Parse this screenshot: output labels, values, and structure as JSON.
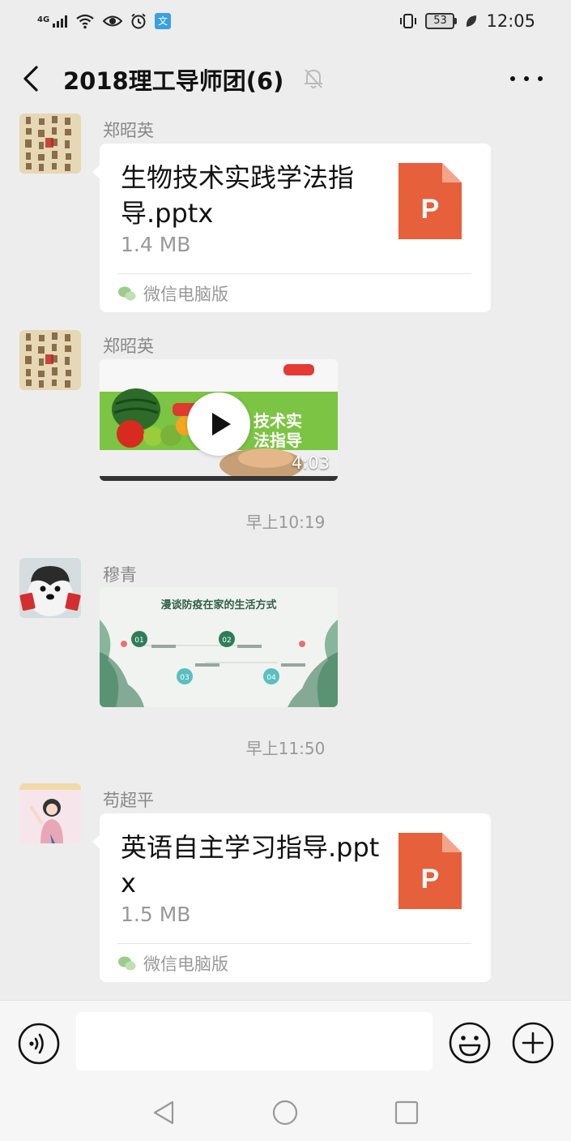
{
  "status_bar": {
    "network": "4G",
    "battery": "53",
    "time": "12:05"
  },
  "header": {
    "title": "2018理工导师团(6)"
  },
  "messages": [
    {
      "sender": "郑昭英",
      "type": "file",
      "file_name": "生物技术实践学法指导.pptx",
      "file_size": "1.4 MB",
      "file_badge": "P",
      "source": "微信电脑版"
    },
    {
      "sender": "郑昭英",
      "type": "video",
      "thumb_title": "技术实\n法指导",
      "duration": "4:03"
    },
    {
      "type": "timestamp",
      "text": "早上10:19"
    },
    {
      "sender": "穆青",
      "type": "image",
      "slide_title": "漫谈防疫在家的生活方式",
      "slide_items": [
        "01",
        "02",
        "03",
        "04"
      ]
    },
    {
      "type": "timestamp",
      "text": "早上11:50"
    },
    {
      "sender": "苟超平",
      "type": "file",
      "file_name": "英语自主学习指导.pptx",
      "file_size": "1.5 MB",
      "file_badge": "P",
      "source": "微信电脑版"
    }
  ],
  "input": {
    "placeholder": ""
  },
  "colors": {
    "background": "#ededed",
    "bubble": "#ffffff",
    "ppt_icon": "#e6603c",
    "muted_text": "#999999"
  },
  "icons": [
    "back-icon",
    "mute-bell-icon",
    "more-icon",
    "voice-icon",
    "emoji-icon",
    "plus-icon",
    "nav-back-icon",
    "nav-home-icon",
    "nav-recent-icon",
    "play-icon",
    "wechat-pc-icon",
    "ppt-file-icon"
  ]
}
